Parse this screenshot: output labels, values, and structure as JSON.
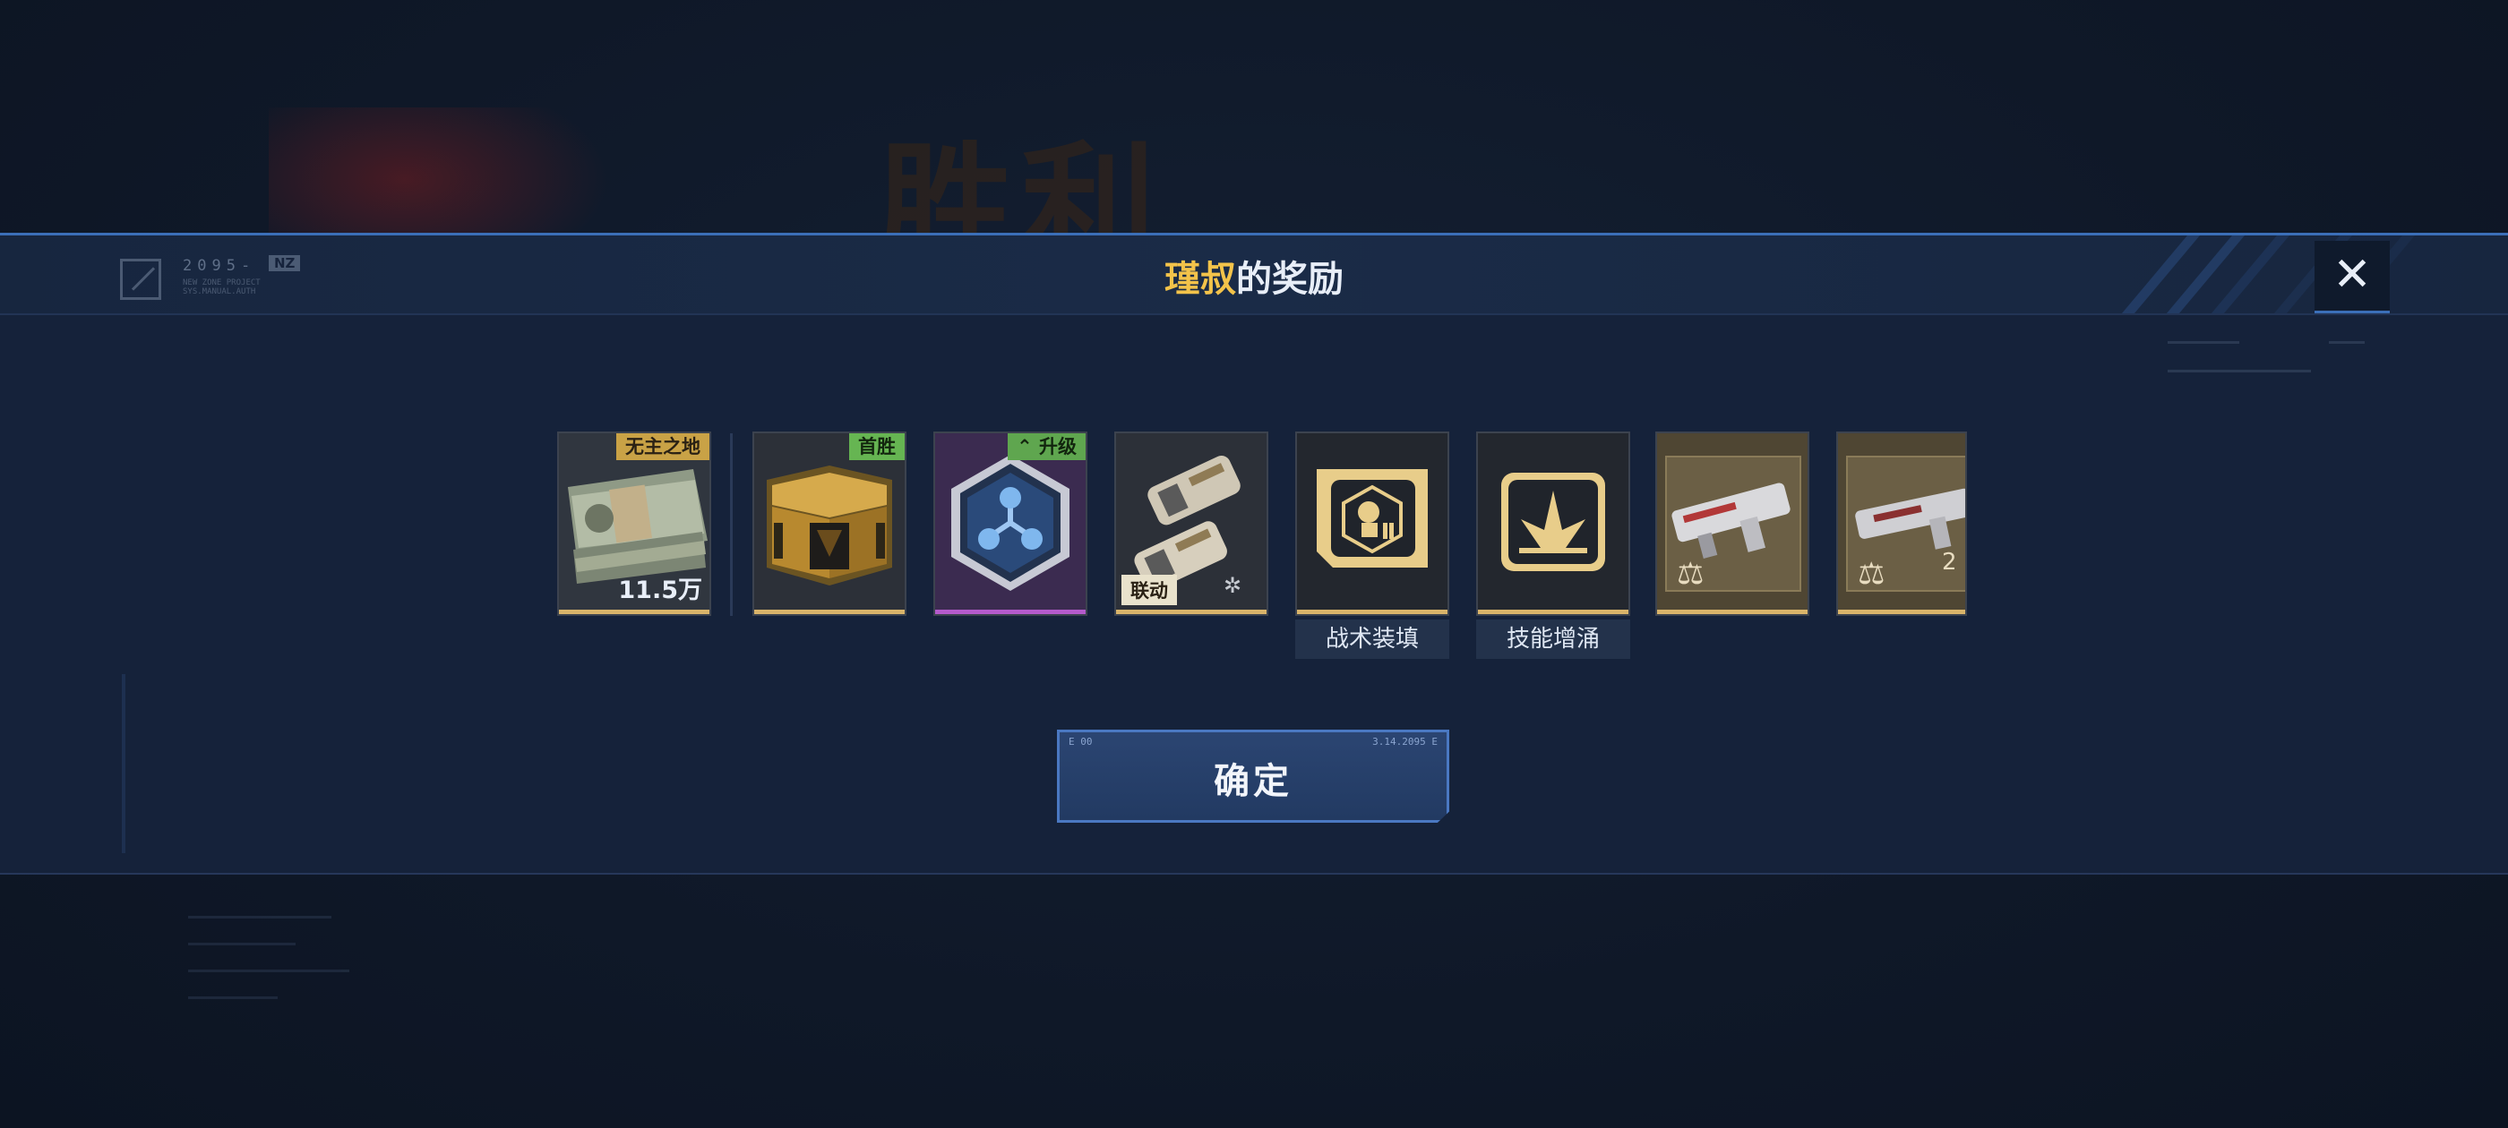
{
  "background": {
    "victory_text": "胜利"
  },
  "modal": {
    "title_highlight": "瑾叔",
    "title_rest": "的奖励",
    "logo_text": "2095-",
    "logo_tag": "NZ",
    "logo_subtext": "NEW ZONE PROJECT SYS.MANUAL.AUTH",
    "close_label": "✕"
  },
  "rewards": [
    {
      "id": "cash",
      "badge": "无主之地",
      "amount": "11.5万",
      "icon": "cash-stack-icon"
    },
    {
      "id": "chest",
      "badge": "首胜",
      "icon": "treasure-chest-icon"
    },
    {
      "id": "upgrade",
      "badge": "升级",
      "icon": "hexagon-molecule-icon"
    },
    {
      "id": "gloves",
      "badge": "联动",
      "icon": "mech-gloves-icon"
    },
    {
      "id": "tactical",
      "label": "战术装填",
      "icon": "tactical-reload-icon"
    },
    {
      "id": "skill",
      "label": "技能增涌",
      "icon": "skill-surge-icon"
    },
    {
      "id": "blueprint1",
      "icon": "weapon-blueprint-icon"
    },
    {
      "id": "blueprint2",
      "icon": "weapon-blueprint-icon"
    }
  ],
  "confirm": {
    "label": "确定",
    "corner_left": "E 00",
    "corner_right": "3.14.2095 E"
  },
  "colors": {
    "accent": "#3b6fb8",
    "gold": "#f3c34a",
    "badge_gold": "#c9a246",
    "badge_green": "#66b552",
    "rarity_purple": "#b45acb",
    "rarity_gold": "#d9b46a"
  }
}
